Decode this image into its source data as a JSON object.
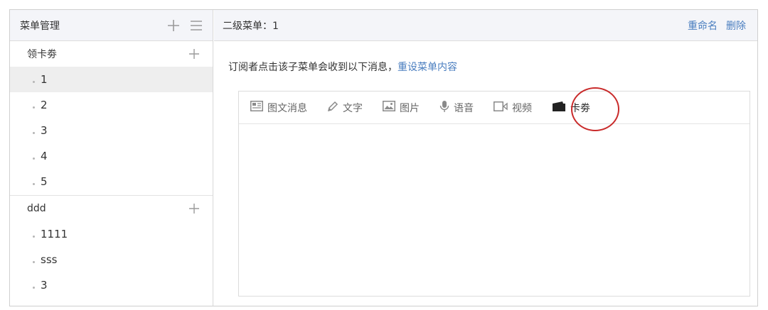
{
  "sidebar": {
    "title": "菜单管理",
    "groups": [
      {
        "label": "领卡劵",
        "items": [
          "1",
          "2",
          "3",
          "4",
          "5"
        ]
      },
      {
        "label": "ddd",
        "items": [
          "1111",
          "sss",
          "3"
        ]
      }
    ]
  },
  "main": {
    "title": "二级菜单：1",
    "rename_label": "重命名",
    "delete_label": "删除",
    "notice_text": "订阅者点击该子菜单会收到以下消息，",
    "notice_link": "重设菜单内容",
    "tabs": [
      {
        "label": "图文消息",
        "icon": "news-icon"
      },
      {
        "label": "文字",
        "icon": "pencil-icon"
      },
      {
        "label": "图片",
        "icon": "image-icon"
      },
      {
        "label": "语音",
        "icon": "microphone-icon"
      },
      {
        "label": "视频",
        "icon": "video-icon"
      },
      {
        "label": "卡劵",
        "icon": "card-icon"
      }
    ]
  },
  "colors": {
    "link": "#4a7ebf",
    "header_bg": "#f4f5f9",
    "highlight": "#c92b2b"
  }
}
